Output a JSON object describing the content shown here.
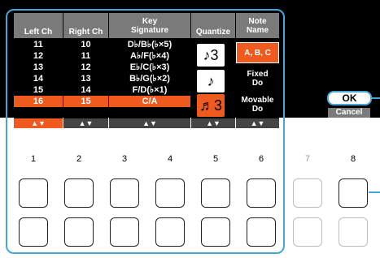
{
  "columns": {
    "left_ch": {
      "header": [
        "Left Ch"
      ],
      "values": [
        "11",
        "12",
        "13",
        "14",
        "15",
        "16"
      ],
      "selected": 5
    },
    "right_ch": {
      "header": [
        "Right Ch"
      ],
      "values": [
        "10",
        "11",
        "12",
        "13",
        "14",
        "15"
      ],
      "selected": 5
    },
    "key_signature": {
      "header": [
        "Key",
        "Signature"
      ],
      "values": [
        "D♭/B♭(♭×5)",
        "A♭/F(♭×4)",
        "E♭/C(♭×3)",
        "B♭/G(♭×2)",
        "F/D(♭×1)",
        "C/A"
      ],
      "selected": 5
    },
    "quantize": {
      "header": [
        "Quantize"
      ],
      "values": [
        "♪3",
        "♪",
        "♬3"
      ],
      "selected": 2
    },
    "note_name": {
      "header": [
        "Note",
        "Name"
      ],
      "values": [
        [
          "A, B, C"
        ],
        [
          "Fixed",
          "Do"
        ],
        [
          "Movable",
          "Do"
        ]
      ],
      "selected": 0
    }
  },
  "arrows": "▲▼",
  "buttons": {
    "ok": "OK",
    "cancel": "Cancel"
  },
  "panel_numbers": [
    "1",
    "2",
    "3",
    "4",
    "5",
    "6",
    "7",
    "8"
  ],
  "colors": {
    "accent": "#ef5a1f",
    "callout": "#46a6d6",
    "header": "#7a7a7a"
  }
}
